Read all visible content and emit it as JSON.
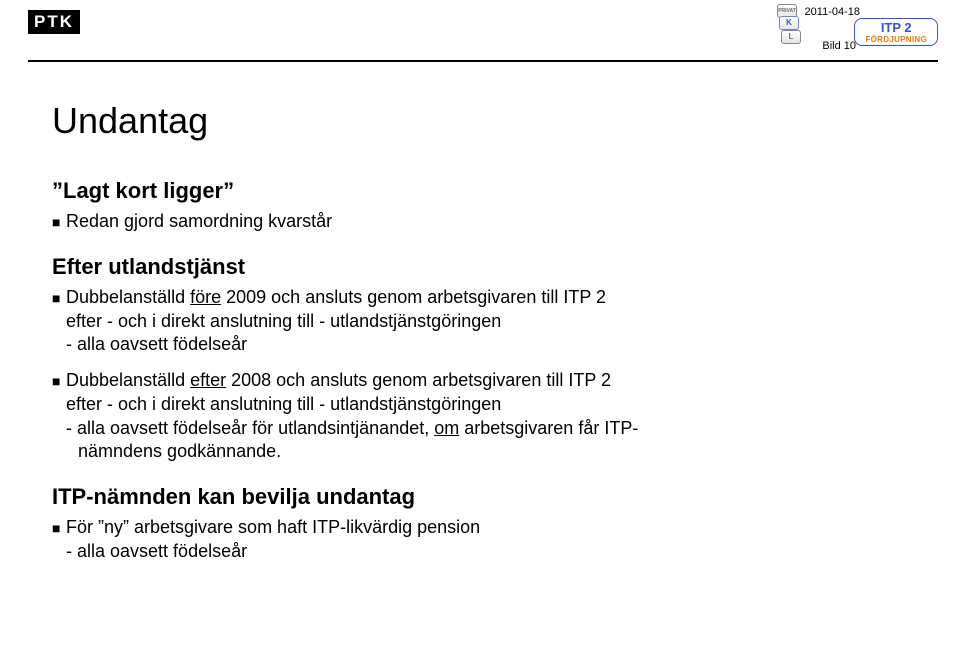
{
  "header": {
    "logo": "PTK",
    "date": "2011-04-18",
    "slide": "Bild 10",
    "itp2_title": "ITP 2",
    "itp2_sub": "FÖRDJUPNING",
    "card_privat": "PRIVAT",
    "card_k": "K",
    "card_l": "L"
  },
  "title": "Undantag",
  "section1": {
    "heading": "”Lagt kort ligger”",
    "b1": "Redan gjord samordning kvarstår"
  },
  "section2": {
    "heading": "Efter utlandstjänst",
    "b1_a": "Dubbelanställd ",
    "b1_u": "före",
    "b1_b": " 2009 och ansluts genom arbetsgivaren till ITP 2",
    "b1_l2": "efter - och i direkt anslutning till - utlandstjänstgöringen",
    "b1_l3": "- alla oavsett födelseår",
    "b2_a": "Dubbelanställd ",
    "b2_u": "efter",
    "b2_b": " 2008 och ansluts genom arbetsgivaren till ITP 2",
    "b2_l2": "efter - och i direkt anslutning till - utlandstjänstgöringen",
    "b2_l3a": "- alla oavsett födelseår för utlandsintjänandet, ",
    "b2_l3u": "om",
    "b2_l3b": " arbetsgivaren får ITP-",
    "b2_l4": "nämndens godkännande."
  },
  "section3": {
    "heading": "ITP-nämnden kan bevilja undantag",
    "b1": "För ”ny” arbetsgivare som haft ITP-likvärdig pension",
    "b1_l2": "- alla oavsett födelseår"
  }
}
